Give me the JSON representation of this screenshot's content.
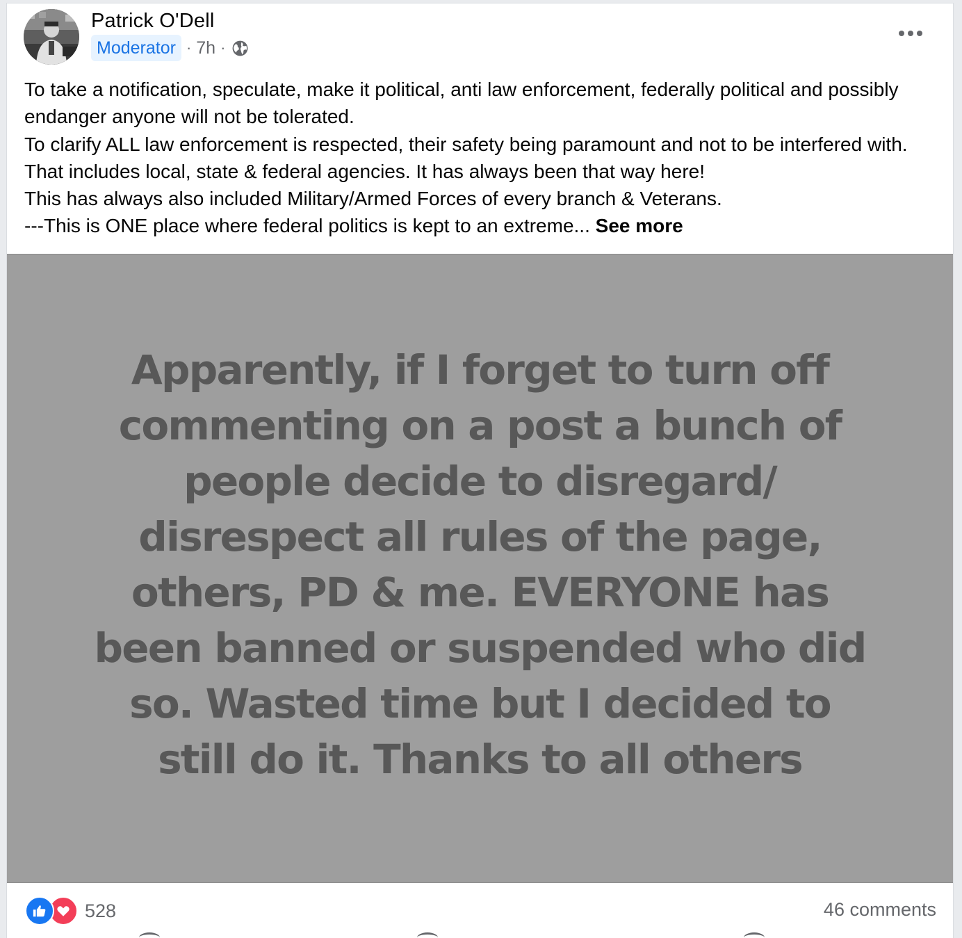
{
  "post": {
    "author": {
      "name": "Patrick O'Dell",
      "role_badge": "Moderator"
    },
    "meta": {
      "time": "7h",
      "separator": "·",
      "audience_icon": "globe-icon"
    },
    "menu_icon": "more-options-icon",
    "text_lines": [
      "To take a notification, speculate, make it political, anti law enforcement, federally political and possibly endanger anyone will not be tolerated.",
      "To clarify ALL law enforcement is respected, their safety being paramount and not to be interfered with. That includes local, state & federal agencies. It has always been that way here!",
      "This has always also included Military/Armed Forces of every branch & Veterans.",
      "---This is ONE place where federal politics is kept to an extreme..."
    ],
    "see_more_label": "See more",
    "image_text": "Apparently, if I forget to turn off commenting on a post a bunch of people decide to disregard/ disrespect all rules of the page, others, PD & me. EVERYONE has been banned or suspended who did so. Wasted time but I decided to still do it. Thanks to all others",
    "image_background": "#9e9e9e",
    "reactions": {
      "types": [
        "like-icon",
        "love-icon"
      ],
      "count": "528",
      "like_color": "#1877f2",
      "love_color": "#f33e58"
    },
    "comments_count": "46 comments"
  }
}
